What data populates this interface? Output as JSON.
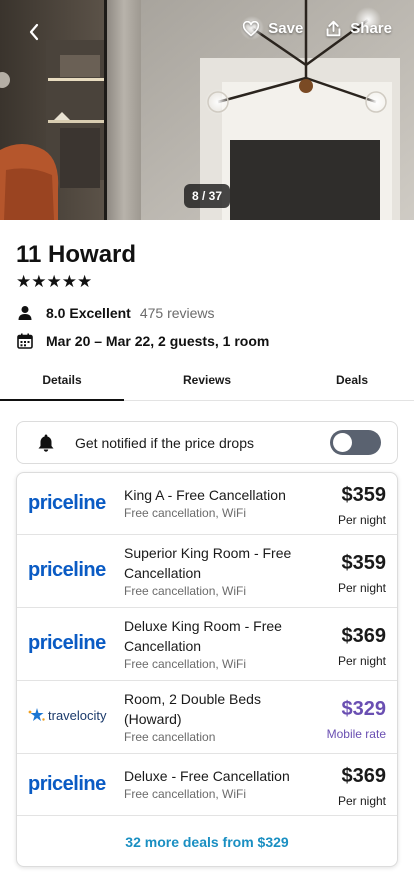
{
  "hero": {
    "back_icon": "chevron-left-icon",
    "save_label": "Save",
    "share_label": "Share",
    "photo_counter": "8 / 37"
  },
  "hotel": {
    "name": "11 Howard",
    "stars": "★★★★★",
    "star_rating": 5,
    "rating_score": "8.0 Excellent",
    "reviews": "475 reviews",
    "dates": "Mar 20 – Mar 22, 2 guests, 1 room"
  },
  "tabs": [
    {
      "label": "Details",
      "active": true
    },
    {
      "label": "Reviews",
      "active": false
    },
    {
      "label": "Deals",
      "active": false
    }
  ],
  "price_alert": {
    "label": "Get notified if the price drops",
    "enabled": false
  },
  "deals": [
    {
      "provider": "priceline",
      "logo_text": "priceline",
      "room": "King A - Free Cancellation",
      "features": "Free cancellation, WiFi",
      "price": "$359",
      "price_note": "Per night"
    },
    {
      "provider": "priceline",
      "logo_text": "priceline",
      "room": "Superior King Room - Free Cancellation",
      "features": "Free cancellation, WiFi",
      "price": "$359",
      "price_note": "Per night"
    },
    {
      "provider": "priceline",
      "logo_text": "priceline",
      "room": "Deluxe King Room - Free Cancellation",
      "features": "Free cancellation, WiFi",
      "price": "$369",
      "price_note": "Per night"
    },
    {
      "provider": "travelocity",
      "logo_text": "travelocity",
      "room": "Room, 2 Double Beds (Howard)",
      "features": "Free cancellation",
      "price": "$329",
      "price_note": "Mobile rate"
    },
    {
      "provider": "priceline",
      "logo_text": "priceline",
      "room": "Deluxe - Free Cancellation",
      "features": "Free cancellation, WiFi",
      "price": "$369",
      "price_note": "Per night"
    }
  ],
  "more_deals": "32 more deals from $329",
  "colors": {
    "priceline_blue": "#0a5bc4",
    "mobile_rate_purple": "#6a4fb2",
    "link_blue": "#1a8fc2",
    "toggle_off": "#5a6270"
  }
}
